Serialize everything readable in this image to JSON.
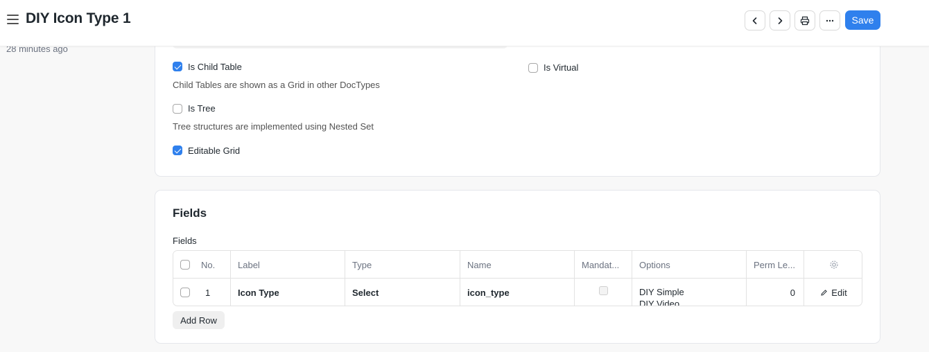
{
  "header": {
    "title": "DIY Icon Type 1",
    "save_label": "Save"
  },
  "sidebar": {
    "modified": "28 minutes ago"
  },
  "settings": {
    "is_child_table": {
      "label": "Is Child Table",
      "checked": true,
      "description": "Child Tables are shown as a Grid in other DocTypes"
    },
    "is_tree": {
      "label": "Is Tree",
      "checked": false,
      "description": "Tree structures are implemented using Nested Set"
    },
    "editable_grid": {
      "label": "Editable Grid",
      "checked": true
    },
    "is_virtual": {
      "label": "Is Virtual",
      "checked": false
    }
  },
  "fields_section": {
    "title": "Fields",
    "table_label": "Fields",
    "columns": [
      "No.",
      "Label",
      "Type",
      "Name",
      "Mandat...",
      "Options",
      "Perm Le..."
    ],
    "rows": [
      {
        "no": "1",
        "label": "Icon Type",
        "type": "Select",
        "name": "icon_type",
        "mandatory": false,
        "options": [
          "DIY Simple",
          "DIY Video"
        ],
        "perm_level": "0",
        "edit_label": "Edit"
      }
    ],
    "add_row_label": "Add Row"
  },
  "colors": {
    "primary": "#2f80ed",
    "background": "#f8f8f8",
    "card": "#ffffff",
    "border": "#e2e2e2"
  },
  "icons": [
    "menu-icon",
    "chevron-left-icon",
    "chevron-right-icon",
    "printer-icon",
    "more-horizontal-icon",
    "gear-icon",
    "pencil-icon",
    "check-icon"
  ]
}
